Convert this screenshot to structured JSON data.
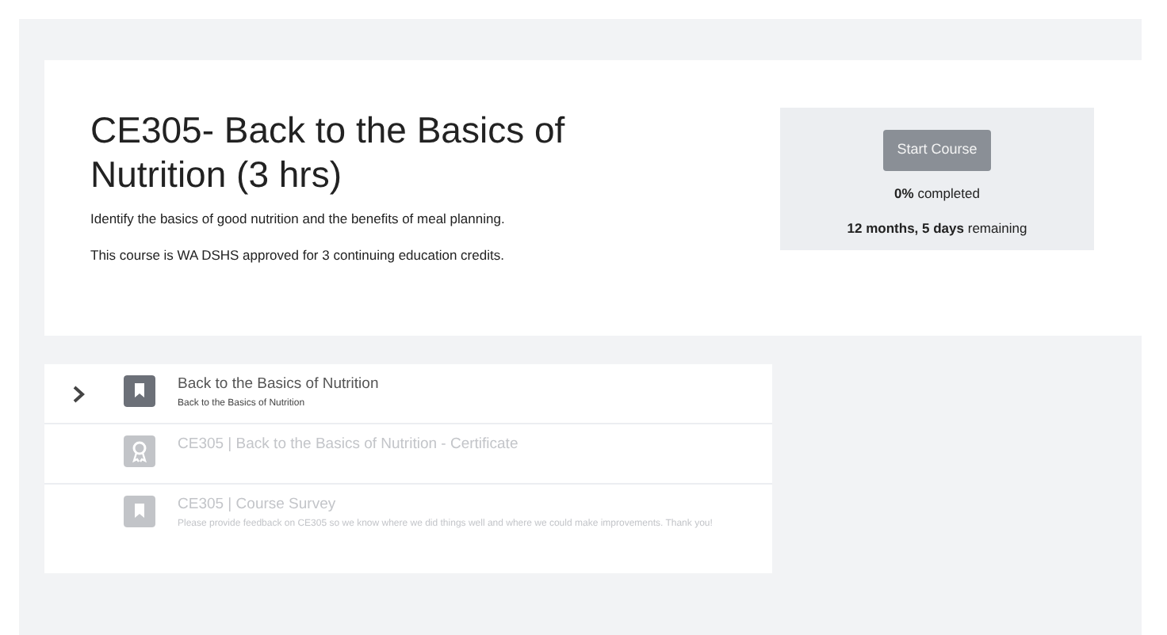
{
  "course": {
    "title": "CE305- Back to the Basics of Nutrition (3 hrs)",
    "description": "Identify the basics of good nutrition and the benefits of meal planning.",
    "approval": "This course is WA DSHS approved for 3 continuing education credits."
  },
  "progress_panel": {
    "button": "Start Course",
    "completed": "**0%** completed",
    "remaining": "**12 months, 5 days** remaining"
  },
  "lessons": [
    {
      "kind": "lesson",
      "title": "Back to the Basics of Nutrition",
      "subtitle": "Back to the Basics of Nutrition",
      "selected": true,
      "disabled": false
    },
    {
      "kind": "certificate",
      "title": "CE305 | Back to the Basics of Nutrition - Certificate",
      "selected": false,
      "disabled": true
    },
    {
      "kind": "lesson",
      "title": "CE305 | Course Survey",
      "subtitle": "Please provide feedback on CE305 so we know where we did things well and where we could make improvements. Thank you!",
      "selected": false,
      "disabled": true
    }
  ]
}
